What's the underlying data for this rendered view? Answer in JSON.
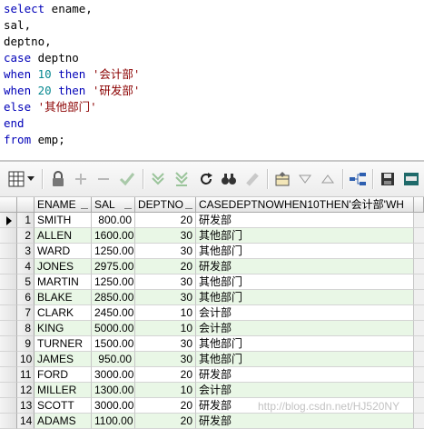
{
  "editor": {
    "lines": [
      {
        "a": "select",
        "b": " ename,"
      },
      {
        "a": "sal,"
      },
      {
        "a": "deptno,"
      },
      {
        "a": "case",
        "b": " deptno"
      },
      {
        "a": "when",
        "b": "10",
        "c": "then",
        "d": "'会计部'"
      },
      {
        "a": "when",
        "b": "20",
        "c": "then",
        "d": "'研发部'"
      },
      {
        "a": "else",
        "d": "'其他部门'"
      },
      {
        "a": "end"
      },
      {
        "a": "from",
        "b": " emp;"
      }
    ]
  },
  "toolbar": {
    "icons": [
      "grid-view-icon",
      "dropdown-arrow-icon",
      "lock-icon",
      "add-record-icon",
      "delete-record-icon",
      "post-changes-icon",
      "fetch-next-icon",
      "fetch-last-icon",
      "refresh-icon",
      "find-icon",
      "clear-icon",
      "query-by-example-icon",
      "sort-desc-icon",
      "sort-asc-icon",
      "link-icon",
      "save-icon",
      "export-icon"
    ]
  },
  "grid": {
    "columns": [
      "ENAME",
      "SAL",
      "DEPTNO",
      "CASEDEPTNOWHEN10THEN'会计部'WH"
    ],
    "rows": [
      {
        "no": "1",
        "ename": "SMITH",
        "sal": "800.00",
        "deptno": "20",
        "case": "研发部"
      },
      {
        "no": "2",
        "ename": "ALLEN",
        "sal": "1600.00",
        "deptno": "30",
        "case": "其他部门"
      },
      {
        "no": "3",
        "ename": "WARD",
        "sal": "1250.00",
        "deptno": "30",
        "case": "其他部门"
      },
      {
        "no": "4",
        "ename": "JONES",
        "sal": "2975.00",
        "deptno": "20",
        "case": "研发部"
      },
      {
        "no": "5",
        "ename": "MARTIN",
        "sal": "1250.00",
        "deptno": "30",
        "case": "其他部门"
      },
      {
        "no": "6",
        "ename": "BLAKE",
        "sal": "2850.00",
        "deptno": "30",
        "case": "其他部门"
      },
      {
        "no": "7",
        "ename": "CLARK",
        "sal": "2450.00",
        "deptno": "10",
        "case": "会计部"
      },
      {
        "no": "8",
        "ename": "KING",
        "sal": "5000.00",
        "deptno": "10",
        "case": "会计部"
      },
      {
        "no": "9",
        "ename": "TURNER",
        "sal": "1500.00",
        "deptno": "30",
        "case": "其他部门"
      },
      {
        "no": "10",
        "ename": "JAMES",
        "sal": "950.00",
        "deptno": "30",
        "case": "其他部门"
      },
      {
        "no": "11",
        "ename": "FORD",
        "sal": "3000.00",
        "deptno": "20",
        "case": "研发部"
      },
      {
        "no": "12",
        "ename": "MILLER",
        "sal": "1300.00",
        "deptno": "10",
        "case": "会计部"
      },
      {
        "no": "13",
        "ename": "SCOTT",
        "sal": "3000.00",
        "deptno": "20",
        "case": "研发部"
      },
      {
        "no": "14",
        "ename": "ADAMS",
        "sal": "1100.00",
        "deptno": "20",
        "case": "研发部"
      }
    ]
  },
  "watermark": "http://blog.csdn.net/HJ520NY",
  "colors": {
    "keyword": "#0000b8",
    "number": "#0a8a92",
    "string": "#8b0000",
    "alt_row": "#e9f7e6"
  }
}
